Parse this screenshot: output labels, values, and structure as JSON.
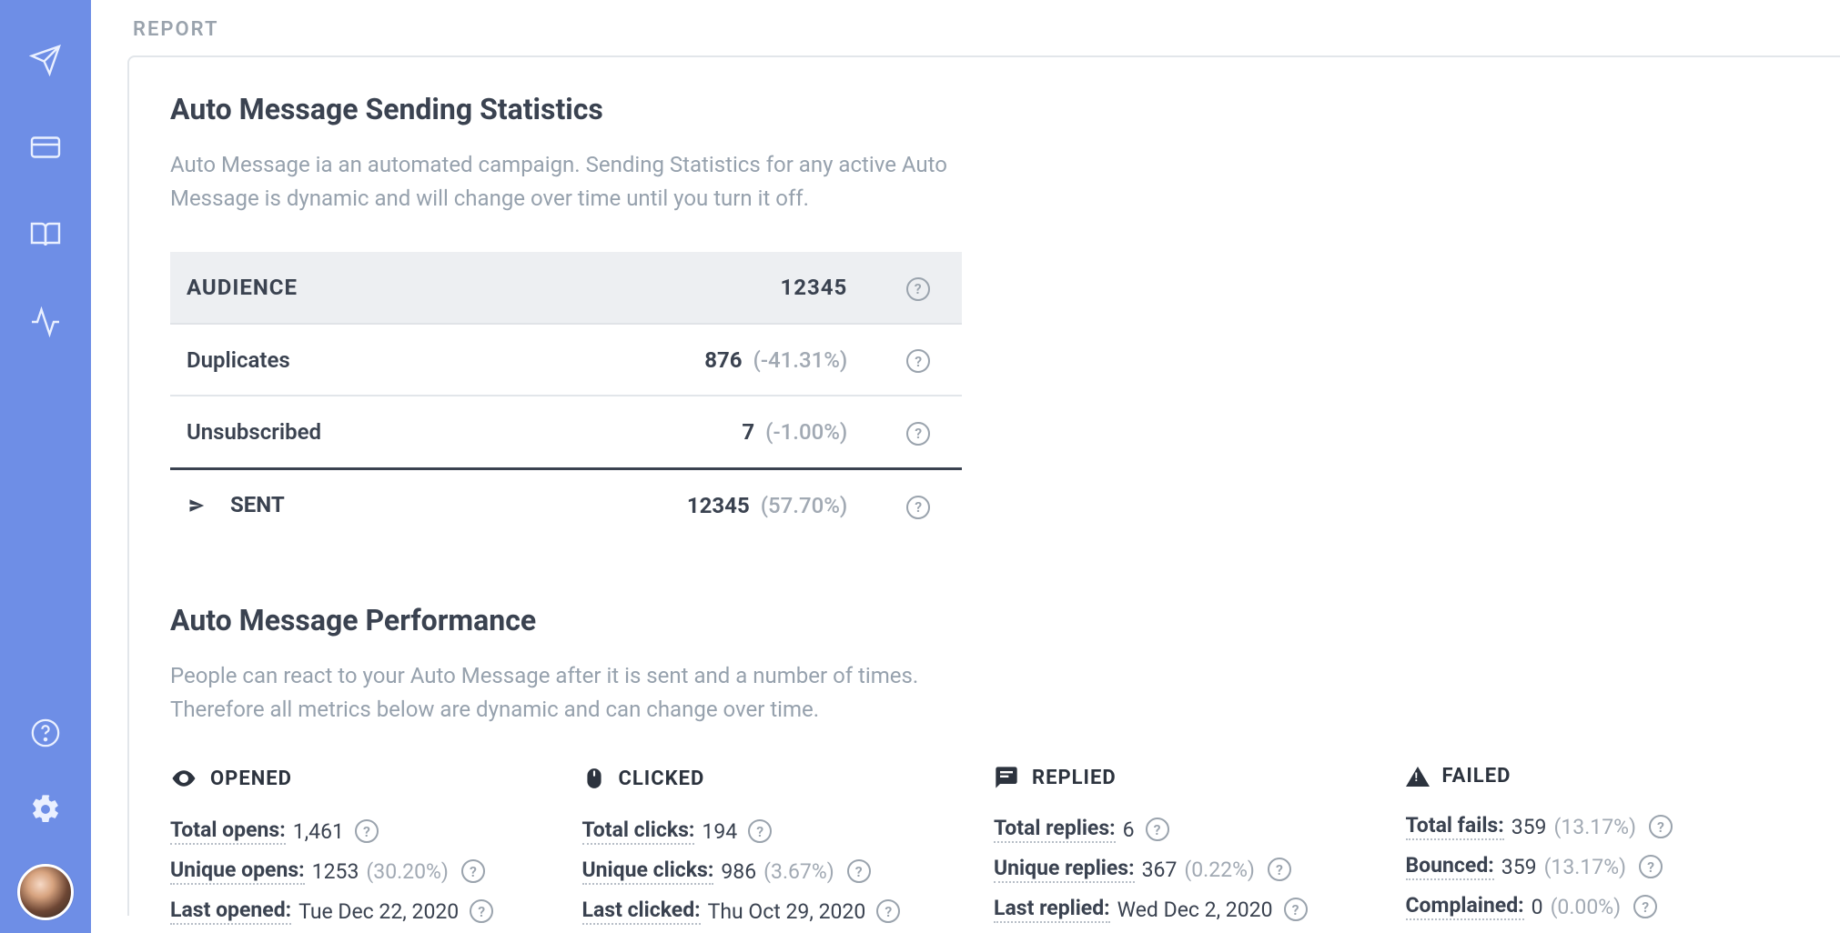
{
  "sidebar": {
    "icons": [
      "send",
      "card",
      "book",
      "activity"
    ],
    "bottom": [
      "help",
      "settings",
      "avatar"
    ]
  },
  "page": {
    "label": "REPORT"
  },
  "sending_stats": {
    "title": "Auto Message Sending Statistics",
    "description": "Auto Message ia an automated campaign. Sending Statistics for any active Auto Message is dynamic and will change over time until you turn it off.",
    "rows": {
      "audience": {
        "label": "AUDIENCE",
        "value": "12345"
      },
      "duplicates": {
        "label": "Duplicates",
        "value": "876",
        "pct": "(-41.31%)"
      },
      "unsubscribed": {
        "label": "Unsubscribed",
        "value": "7",
        "pct": "(-1.00%)"
      },
      "sent": {
        "label": "SENT",
        "value": "12345",
        "pct": "(57.70%)"
      }
    }
  },
  "performance": {
    "title": "Auto Message Performance",
    "description": "People can react to your Auto Message after it is sent and a number of times. Therefore all metrics below are dynamic and can change over time.",
    "opened": {
      "head": "OPENED",
      "total": {
        "label": "Total opens:",
        "value": "1,461"
      },
      "unique": {
        "label": "Unique opens:",
        "value": "1253",
        "pct": "(30.20%)"
      },
      "last": {
        "label": "Last opened:",
        "value": "Tue Dec 22, 2020"
      }
    },
    "clicked": {
      "head": "CLICKED",
      "total": {
        "label": "Total clicks:",
        "value": "194"
      },
      "unique": {
        "label": "Unique clicks:",
        "value": "986",
        "pct": "(3.67%)"
      },
      "last": {
        "label": "Last clicked:",
        "value": "Thu Oct 29, 2020"
      }
    },
    "replied": {
      "head": "REPLIED",
      "total": {
        "label": "Total replies:",
        "value": "6"
      },
      "unique": {
        "label": "Unique replies:",
        "value": "367",
        "pct": "(0.22%)"
      },
      "last": {
        "label": "Last replied:",
        "value": "Wed Dec 2, 2020"
      }
    },
    "failed": {
      "head": "FAILED",
      "total": {
        "label": "Total fails:",
        "value": "359",
        "pct": "(13.17%)"
      },
      "bounced": {
        "label": "Bounced:",
        "value": "359",
        "pct": "(13.17%)"
      },
      "complained": {
        "label": "Complained:",
        "value": "0",
        "pct": "(0.00%)"
      }
    }
  }
}
